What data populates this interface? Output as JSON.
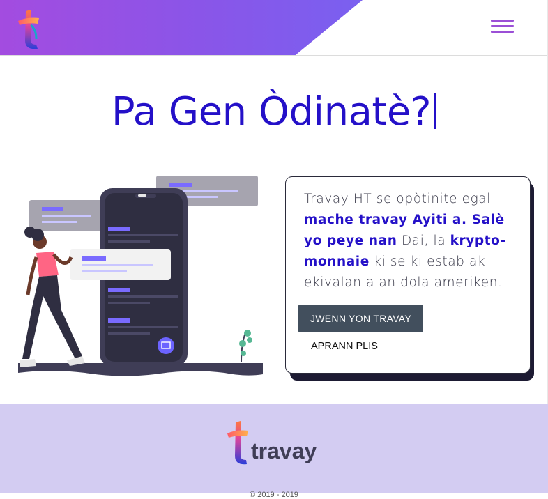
{
  "header": {
    "logo_name": "tt-logo",
    "menu_icon": "hamburger-menu-icon"
  },
  "hero": {
    "title": "Pa Gen Òdinatè?"
  },
  "card": {
    "text_1": "Travay HT se opòtinite egal ",
    "text_bold_1": "mache travay Ayiti a. Salè yo peye nan",
    "text_2": " Dai, la ",
    "text_bold_2": "krypto-monnaie",
    "text_3": " ki se ki estab ak ekivalan a an dola ameriken.",
    "primary_button": "JWENN YON TRAVAY",
    "secondary_link": "APRANN PLIS"
  },
  "footer": {
    "logo_text": "travay",
    "copyright": "© 2019 - 2019"
  },
  "colors": {
    "brand_purple": "#2410c8",
    "header_gradient_start": "#a34ce0",
    "header_gradient_end": "#7a60f0",
    "button_bg": "#424f5d",
    "footer_bg": "#d3ccf2"
  }
}
